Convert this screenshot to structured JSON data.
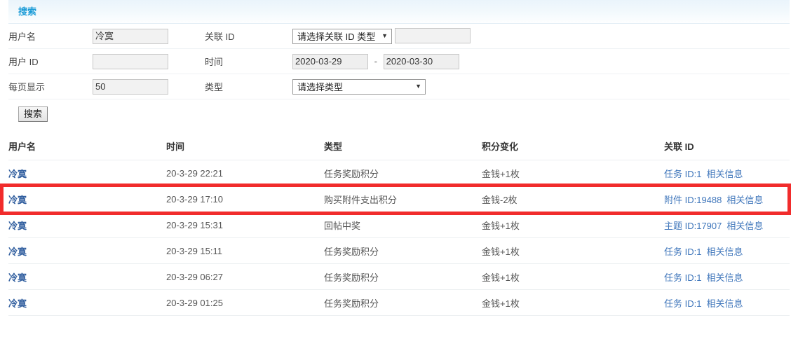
{
  "search": {
    "legend": "搜索",
    "fields": {
      "username_label": "用户名",
      "username_value": "冷寞",
      "relid_label": "关联 ID",
      "relid_select_value": "请选择关联 ID 类型",
      "relid_value": "",
      "userid_label": "用户 ID",
      "userid_value": "",
      "time_label": "时间",
      "date_start": "2020-03-29",
      "date_separator": "-",
      "date_end": "2020-03-30",
      "perpage_label": "每页显示",
      "perpage_value": "50",
      "type_label": "类型",
      "type_select_value": "请选择类型"
    },
    "submit_label": "搜索",
    "caret": "▼"
  },
  "results": {
    "headers": [
      "用户名",
      "时间",
      "类型",
      "积分变化",
      "关联 ID"
    ],
    "rows": [
      {
        "user": "冷寞",
        "time": "20-3-29 22:21",
        "type": "任务奖励积分",
        "points": "金钱+1枚",
        "rel_id": "任务 ID:1",
        "rel_info": "相关信息",
        "highlighted": false
      },
      {
        "user": "冷寞",
        "time": "20-3-29 17:10",
        "type": "购买附件支出积分",
        "points": "金钱-2枚",
        "rel_id": "附件 ID:19488",
        "rel_info": "相关信息",
        "highlighted": true
      },
      {
        "user": "冷寞",
        "time": "20-3-29 15:31",
        "type": "回帖中奖",
        "points": "金钱+1枚",
        "rel_id": "主题 ID:17907",
        "rel_info": "相关信息",
        "highlighted": false
      },
      {
        "user": "冷寞",
        "time": "20-3-29 15:11",
        "type": "任务奖励积分",
        "points": "金钱+1枚",
        "rel_id": "任务 ID:1",
        "rel_info": "相关信息",
        "highlighted": false
      },
      {
        "user": "冷寞",
        "time": "20-3-29 06:27",
        "type": "任务奖励积分",
        "points": "金钱+1枚",
        "rel_id": "任务 ID:1",
        "rel_info": "相关信息",
        "highlighted": false
      },
      {
        "user": "冷寞",
        "time": "20-3-29 01:25",
        "type": "任务奖励积分",
        "points": "金钱+1枚",
        "rel_id": "任务 ID:1",
        "rel_info": "相关信息",
        "highlighted": false
      }
    ]
  },
  "annotation": {
    "highlight_color": "#f12c2c",
    "highlight_row_index": 1
  },
  "colors": {
    "legend_text": "#1a9bd7",
    "link": "#3f76bb",
    "username": "#2f5d9e"
  }
}
